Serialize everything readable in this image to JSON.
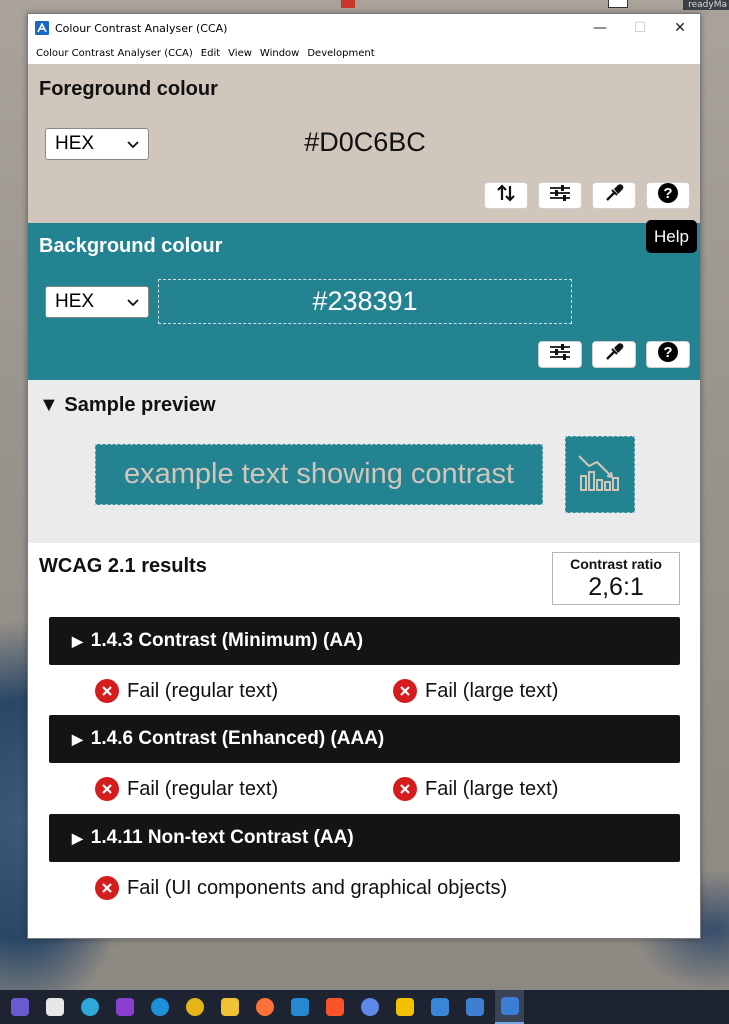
{
  "window": {
    "title": "Colour Contrast Analyser (CCA)",
    "controls": {
      "minimize": "—",
      "maximize": "☐",
      "close": "✕"
    }
  },
  "menubar": {
    "items": [
      "Colour Contrast Analyser (CCA)",
      "Edit",
      "View",
      "Window",
      "Development"
    ]
  },
  "foreground": {
    "title": "Foreground colour",
    "format": "HEX",
    "value": "#D0C6BC",
    "color": "#D0C6BC",
    "buttons": [
      "swap-icon",
      "sliders-icon",
      "eyedropper-icon",
      "help-icon"
    ]
  },
  "background": {
    "title": "Background colour",
    "format": "HEX",
    "value": "#238391",
    "color": "#238391",
    "buttons": [
      "sliders-icon",
      "eyedropper-icon",
      "help-icon"
    ]
  },
  "tooltip": {
    "text": "Help"
  },
  "preview": {
    "title": "Sample preview",
    "toggle": "▼",
    "sample_text": "example text showing contrast",
    "icon": "chart-icon"
  },
  "results": {
    "title": "WCAG 2.1 results",
    "ratio_label": "Contrast ratio",
    "ratio_value": "2,6:1",
    "criteria": [
      {
        "label": "1.4.3 Contrast (Minimum) (AA)",
        "toggle": "▶",
        "results": [
          "Fail (regular text)",
          "Fail (large text)"
        ]
      },
      {
        "label": "1.4.6 Contrast (Enhanced) (AAA)",
        "toggle": "▶",
        "results": [
          "Fail (regular text)",
          "Fail (large text)"
        ]
      },
      {
        "label": "1.4.11 Non-text Contrast (AA)",
        "toggle": "▶",
        "results": [
          "Fail (UI components and graphical objects)"
        ]
      }
    ]
  },
  "desktop": {
    "corner_tag": "readyMa"
  },
  "taskbar": {
    "items": [
      "terminal-icon",
      "inkscape-icon",
      "color-app-icon",
      "game-icon",
      "edge-icon",
      "chrome-icon",
      "files-icon",
      "firefox-icon",
      "vscode-icon",
      "brave-icon",
      "drop-icon",
      "pw-icon",
      "paint-icon",
      "word-doc-icon",
      "cca-icon"
    ],
    "colors": [
      "#6a5acd",
      "#e7e7e7",
      "#2ea8d8",
      "#8a3fd1",
      "#1e8fd9",
      "#e5b419",
      "#f0c236",
      "#ff7139",
      "#2489d1",
      "#fb542b",
      "#5f89e8",
      "#f2c200",
      "#3a86d6",
      "#3f7fd0",
      "#3c7ed6"
    ]
  },
  "colors": {
    "fail": "#D51D1D",
    "criterion_bg": "#141414"
  }
}
